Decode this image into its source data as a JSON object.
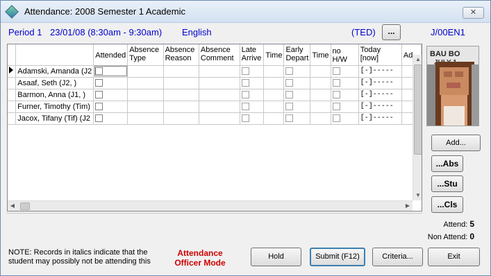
{
  "window": {
    "title": "Attendance: 2008 Semester 1 Academic",
    "close_label": "✕"
  },
  "info": {
    "period": "Period 1",
    "datetime": "23/01/08 (8:30am - 9:30am)",
    "subject": "English",
    "teacher": "(TED)",
    "browse_label": "...",
    "class_code": "J/00EN1"
  },
  "grid": {
    "columns": [
      "",
      "Attended",
      "Absence Type",
      "Absence Reason",
      "Absence Comment",
      "Late Arrive",
      "Time",
      "Early Depart",
      "Time",
      "no H/W",
      "Today [now]",
      "Ad"
    ],
    "rows": [
      {
        "name": "Adamski, Amanda (J2",
        "today": "[-]-----",
        "current": true
      },
      {
        "name": "Asaaf, Seth (J2, )",
        "today": "[-]-----",
        "current": false
      },
      {
        "name": "Barmon, Anna (J1, )",
        "today": "[-]-----",
        "current": false
      },
      {
        "name": "Furner, Timothy (Tim)",
        "today": "[-]-----",
        "current": false
      },
      {
        "name": "Jacox, Tifany (Tif) (J2",
        "today": "[-]-----",
        "current": false
      }
    ]
  },
  "side": {
    "add_label": "Add...",
    "abs_label": "...Abs",
    "stu_label": "...Stu",
    "cls_label": "...Cls",
    "attend_label": "Attend:",
    "attend_count": "5",
    "non_attend_label": "Non Attend:",
    "non_attend_count": "0"
  },
  "footer": {
    "note_line1": "NOTE:  Records in italics indicate that the",
    "note_line2": "student may possibly not be attending this",
    "mode_line1": "Attendance",
    "mode_line2": "Officer Mode",
    "hold_label": "Hold",
    "submit_label": "Submit (F12)",
    "criteria_label": "Criteria...",
    "exit_label": "Exit"
  },
  "colors": {
    "info_text": "#0000cc",
    "mode_text": "#d00000"
  }
}
